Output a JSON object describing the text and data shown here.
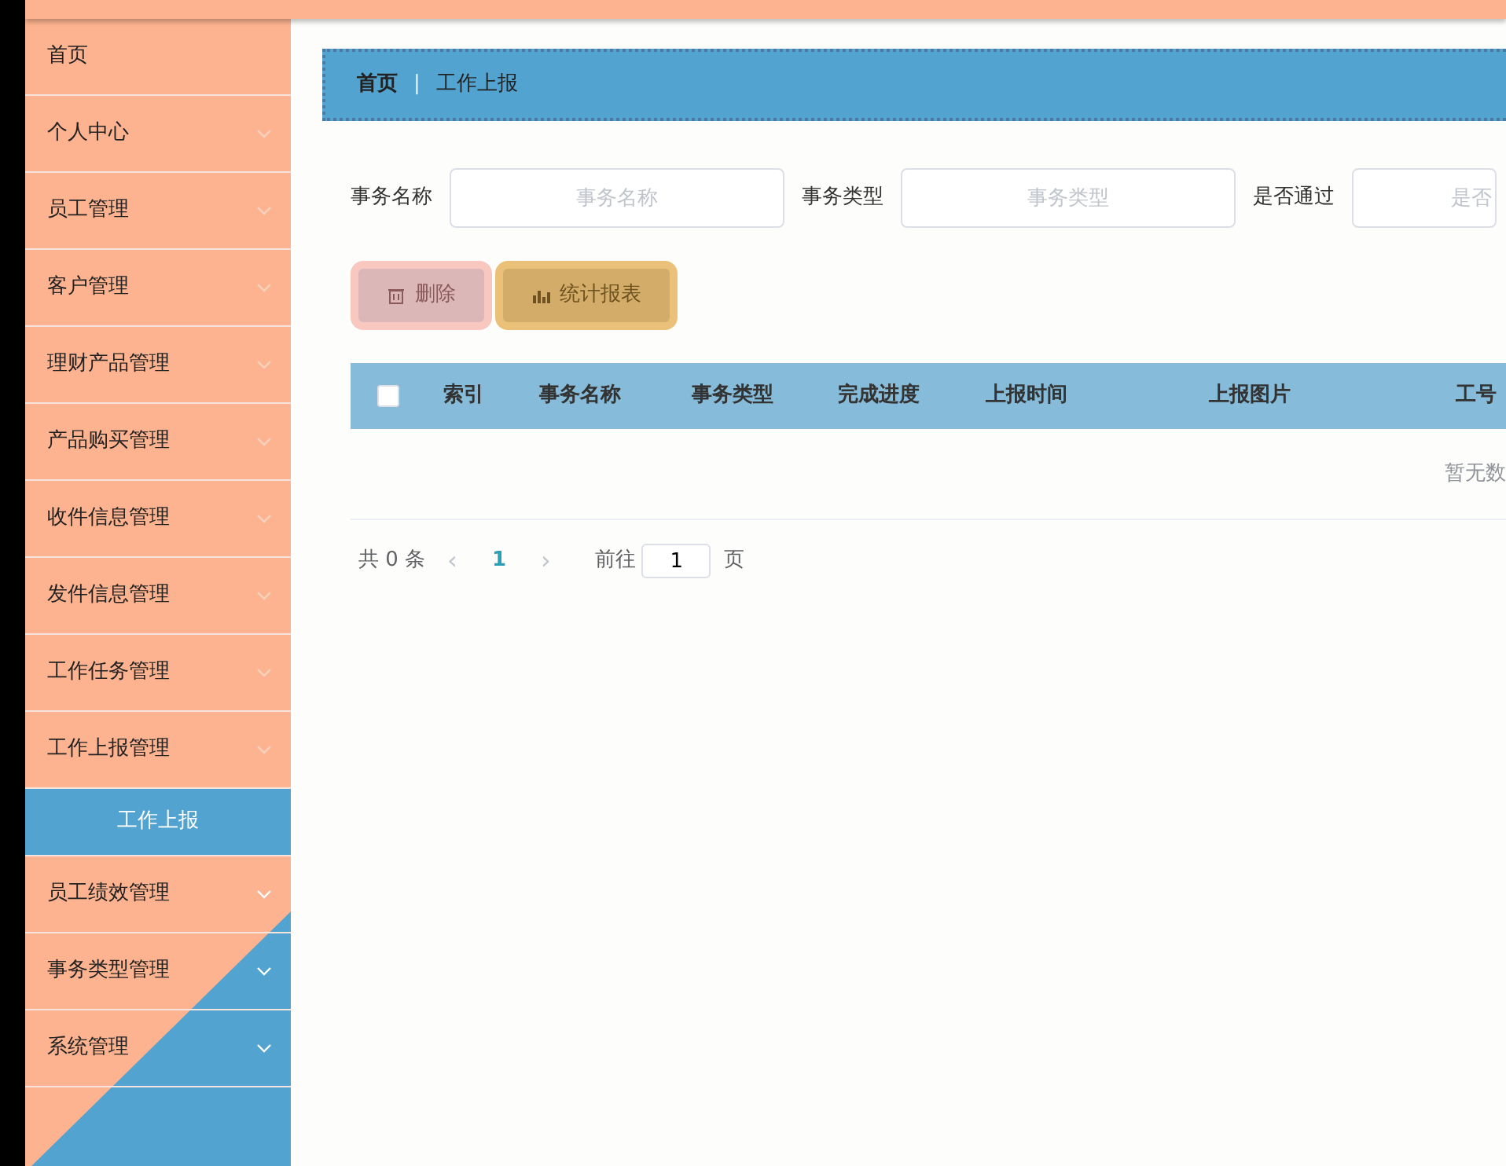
{
  "sidebar": {
    "items": [
      {
        "label": "首页",
        "kind": "link"
      },
      {
        "label": "个人中心",
        "kind": "menu"
      },
      {
        "label": "员工管理",
        "kind": "menu"
      },
      {
        "label": "客户管理",
        "kind": "menu"
      },
      {
        "label": "理财产品管理",
        "kind": "menu"
      },
      {
        "label": "产品购买管理",
        "kind": "menu"
      },
      {
        "label": "收件信息管理",
        "kind": "menu"
      },
      {
        "label": "发件信息管理",
        "kind": "menu"
      },
      {
        "label": "工作任务管理",
        "kind": "menu"
      },
      {
        "label": "工作上报管理",
        "kind": "menu",
        "children": [
          {
            "label": "工作上报",
            "selected": true
          }
        ]
      },
      {
        "label": "员工绩效管理",
        "kind": "menu"
      },
      {
        "label": "事务类型管理",
        "kind": "menu"
      },
      {
        "label": "系统管理",
        "kind": "menu"
      }
    ]
  },
  "breadcrumb": [
    "首页",
    "工作上报"
  ],
  "breadcrumb_separator": "|",
  "search": [
    {
      "label": "事务名称",
      "placeholder": "事务名称"
    },
    {
      "label": "事务类型",
      "placeholder": "事务类型"
    },
    {
      "label": "是否通过",
      "placeholder": "是否"
    }
  ],
  "actions": [
    {
      "label": "删除",
      "kind": "delete"
    },
    {
      "label": "统计报表",
      "kind": "chart"
    }
  ],
  "table": {
    "select_all_checked": false,
    "columns": [
      "索引",
      "事务名称",
      "事务类型",
      "完成进度",
      "上报时间",
      "上报图片",
      "工号"
    ],
    "empty_text": "暂无数"
  },
  "pagination": {
    "total": "共 0 条",
    "prev": "‹",
    "pages": [
      {
        "label": "1",
        "selected": true
      }
    ],
    "next": "›",
    "goto_label": "前往",
    "goto_value": "1",
    "page_unit": "页"
  }
}
